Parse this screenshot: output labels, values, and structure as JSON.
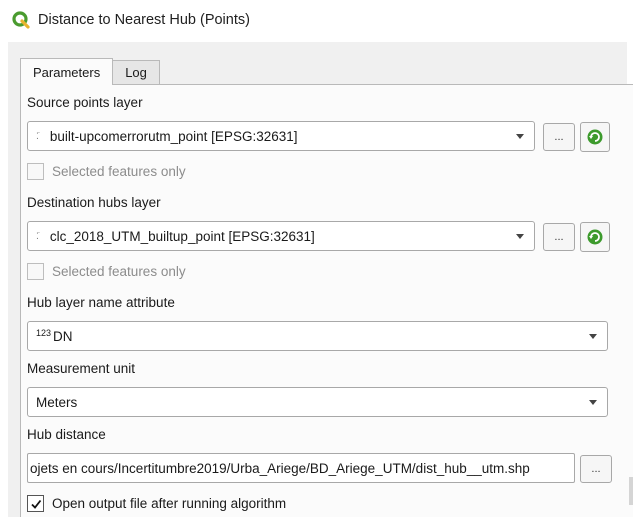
{
  "window": {
    "title": "Distance to Nearest Hub (Points)"
  },
  "tabs": [
    {
      "label": "Parameters"
    },
    {
      "label": "Log"
    }
  ],
  "source_points": {
    "label": "Source points layer",
    "value": "built-upcomerrorutm_point [EPSG:32631]",
    "browse_label": "...",
    "selected_only_label": "Selected features only"
  },
  "destination_hubs": {
    "label": "Destination hubs layer",
    "value": "clc_2018_UTM_builtup_point [EPSG:32631]",
    "browse_label": "...",
    "selected_only_label": "Selected features only"
  },
  "hub_name_attribute": {
    "label": "Hub layer name attribute",
    "type_prefix": "123",
    "value": "DN"
  },
  "measurement_unit": {
    "label": "Measurement unit",
    "value": "Meters"
  },
  "hub_distance": {
    "label": "Hub distance",
    "value": "ojets en cours/Incertitumbre2019/Urba_Ariege/BD_Ariege_UTM/dist_hub__utm.shp",
    "browse_label": "..."
  },
  "open_output": {
    "label": "Open output file after running algorithm",
    "checked": true
  },
  "colors": {
    "qgis_green": "#4a9b2f",
    "refresh_green": "#3c9a2c"
  }
}
